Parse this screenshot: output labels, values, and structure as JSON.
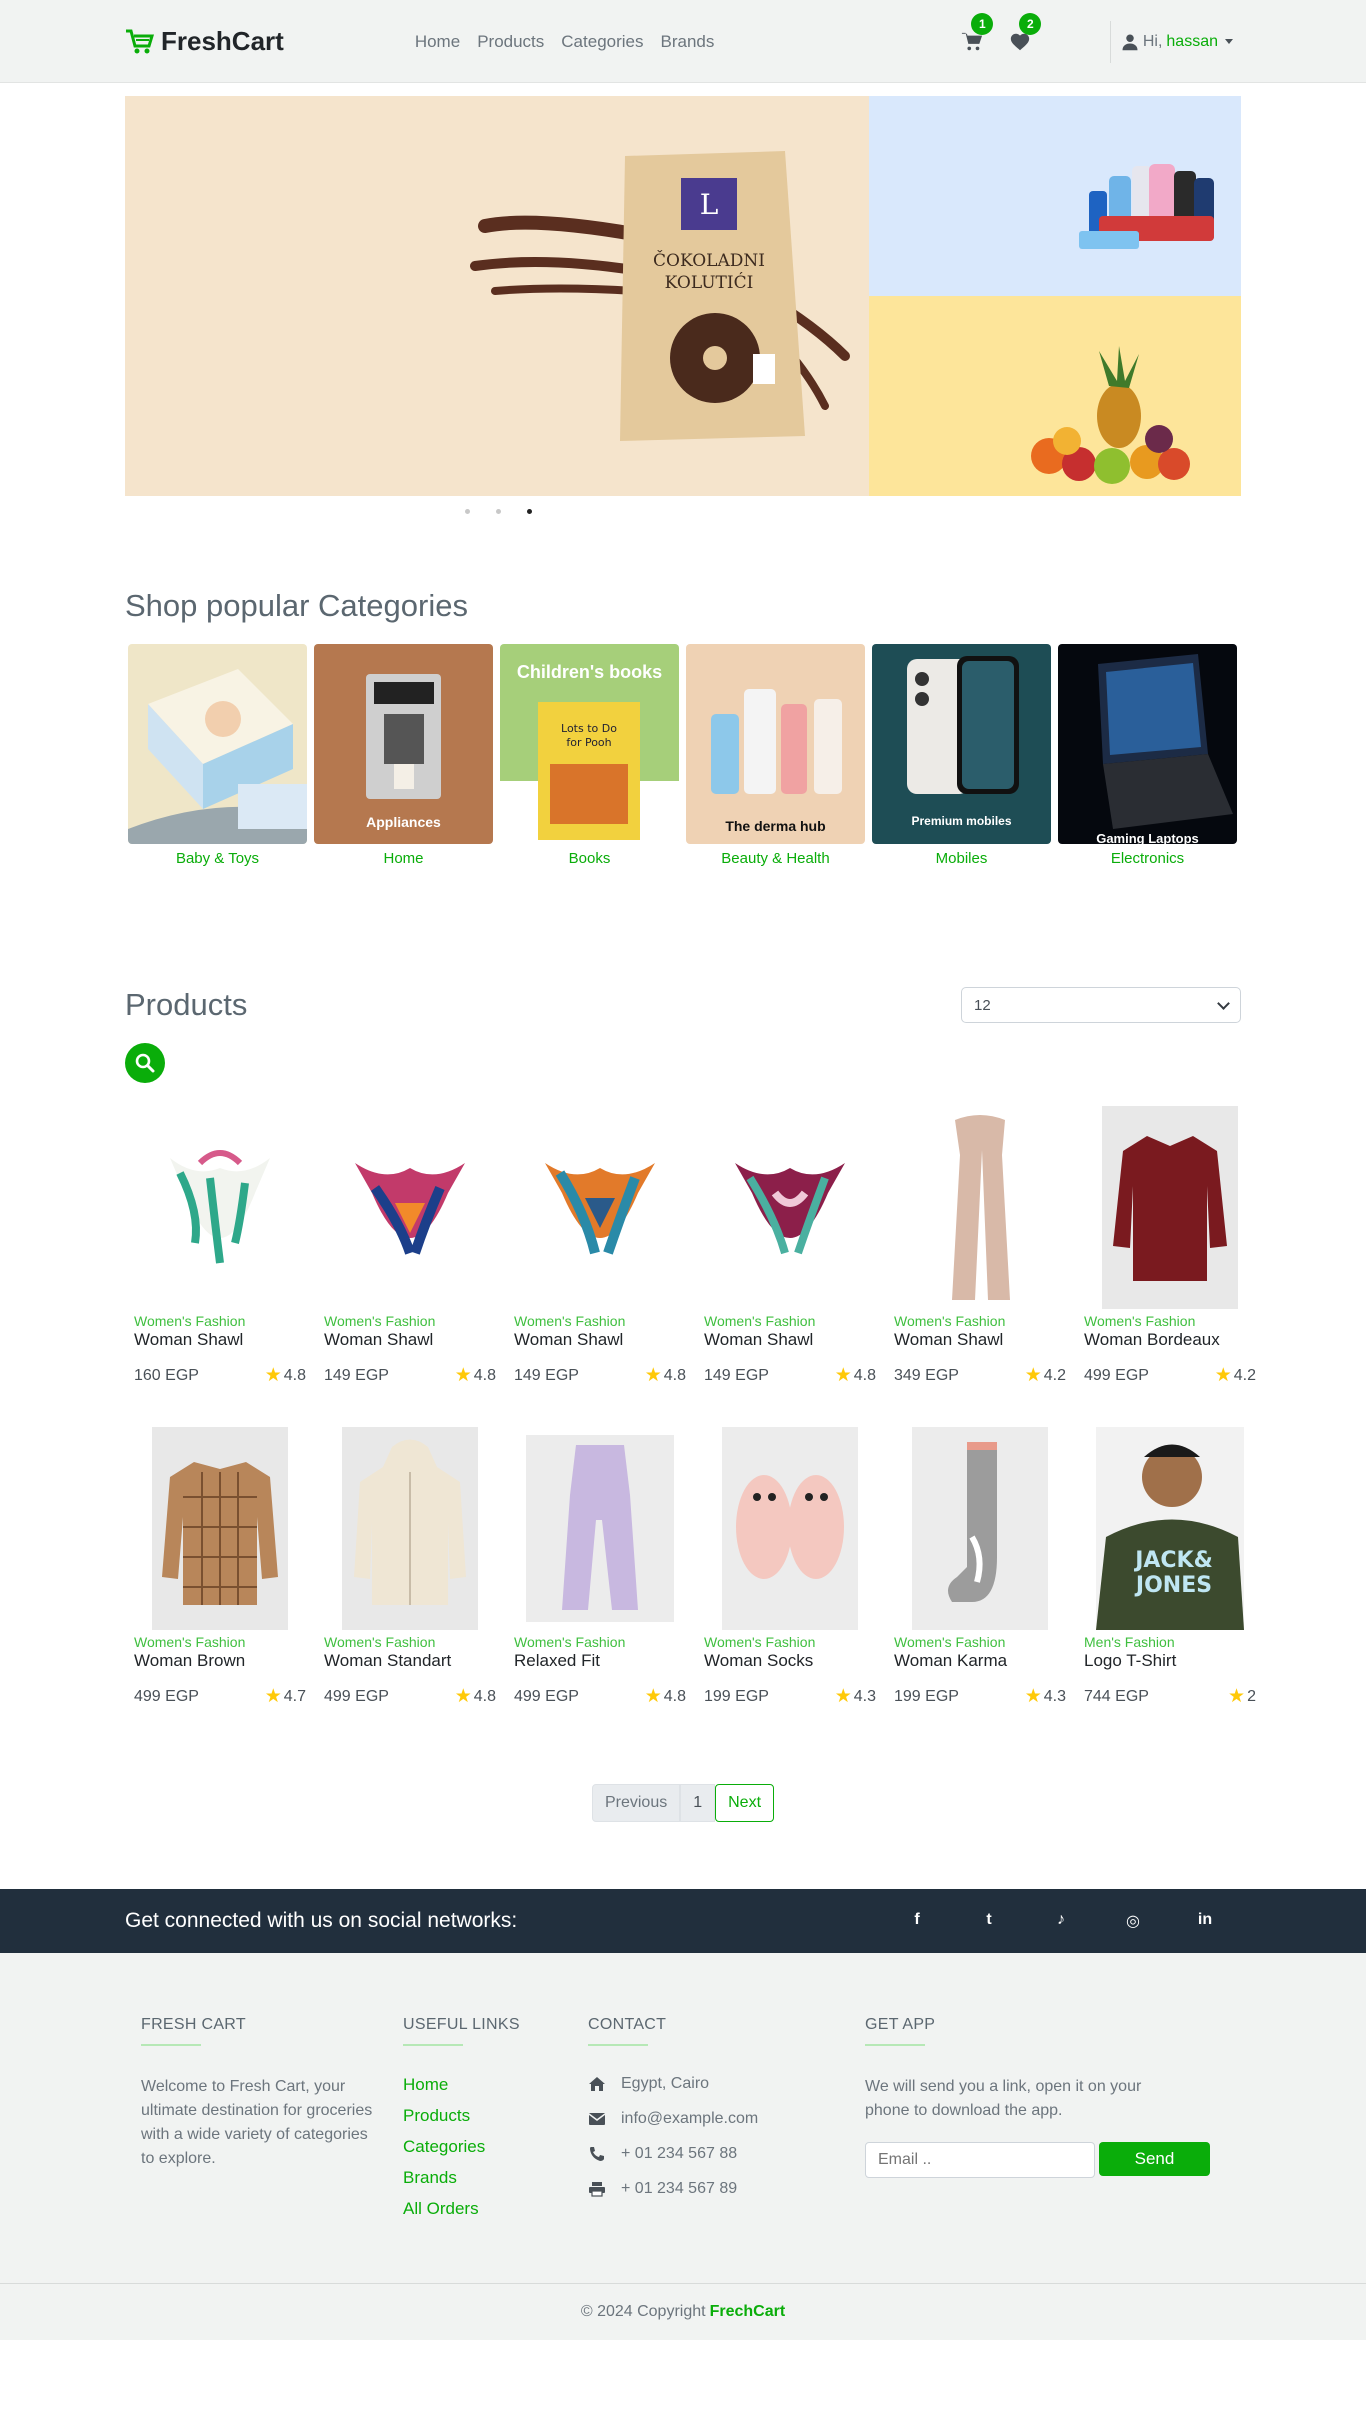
{
  "brand": {
    "name": "FreshCart"
  },
  "nav": {
    "links": [
      "Home",
      "Products",
      "Categories",
      "Brands"
    ]
  },
  "cart": {
    "count": "1"
  },
  "wishlist": {
    "count": "2"
  },
  "user": {
    "greeting": "Hi,",
    "name": "hassan"
  },
  "colors": {
    "accent": "#0aad0a",
    "dark": "#212f3d",
    "navbar_bg": "#f1f3f2"
  },
  "categories": {
    "title": "Shop popular Categories",
    "items": [
      {
        "name": "Baby & Toys",
        "overlay": ""
      },
      {
        "name": "Home",
        "overlay": "Appliances"
      },
      {
        "name": "Books",
        "overlay": "Children's books"
      },
      {
        "name": "Beauty & Health",
        "overlay": "The derma hub"
      },
      {
        "name": "Mobiles",
        "overlay": "Premium mobiles"
      },
      {
        "name": "Electronics",
        "overlay": "Gaming Laptops"
      }
    ]
  },
  "products": {
    "title": "Products",
    "page_size": "12",
    "items": [
      {
        "category": "Women's Fashion",
        "name": "Woman Shawl",
        "price": "160 EGP",
        "rating": "4.8"
      },
      {
        "category": "Women's Fashion",
        "name": "Woman Shawl",
        "price": "149 EGP",
        "rating": "4.8"
      },
      {
        "category": "Women's Fashion",
        "name": "Woman Shawl",
        "price": "149 EGP",
        "rating": "4.8"
      },
      {
        "category": "Women's Fashion",
        "name": "Woman Shawl",
        "price": "149 EGP",
        "rating": "4.8"
      },
      {
        "category": "Women's Fashion",
        "name": "Woman Shawl",
        "price": "349 EGP",
        "rating": "4.2"
      },
      {
        "category": "Women's Fashion",
        "name": "Woman Bordeaux",
        "price": "499 EGP",
        "rating": "4.2"
      },
      {
        "category": "Women's Fashion",
        "name": "Woman Brown",
        "price": "499 EGP",
        "rating": "4.7"
      },
      {
        "category": "Women's Fashion",
        "name": "Woman Standart",
        "price": "499 EGP",
        "rating": "4.8"
      },
      {
        "category": "Women's Fashion",
        "name": "Relaxed Fit",
        "price": "499 EGP",
        "rating": "4.8"
      },
      {
        "category": "Women's Fashion",
        "name": "Woman Socks",
        "price": "199 EGP",
        "rating": "4.3"
      },
      {
        "category": "Women's Fashion",
        "name": "Woman Karma",
        "price": "199 EGP",
        "rating": "4.3"
      },
      {
        "category": "Men's Fashion",
        "name": "Logo T-Shirt",
        "price": "744 EGP",
        "rating": "2"
      }
    ]
  },
  "pagination": {
    "prev": "Previous",
    "current": "1",
    "next": "Next"
  },
  "social": {
    "text": "Get connected with us on social networks:",
    "icons": [
      "facebook-icon",
      "twitter-icon",
      "tiktok-icon",
      "instagram-icon",
      "linkedin-icon"
    ]
  },
  "footer": {
    "about": {
      "title": "FRESH CART",
      "text": "Welcome to Fresh Cart, your ultimate destination for groceries with a wide variety of categories to explore."
    },
    "links": {
      "title": "USEFUL LINKS",
      "items": [
        "Home",
        "Products",
        "Categories",
        "Brands",
        "All Orders"
      ]
    },
    "contact": {
      "title": "CONTACT",
      "address": "Egypt, Cairo",
      "email": "info@example.com",
      "phone": "+ 01 234 567 88",
      "fax": "+ 01 234 567 89"
    },
    "app": {
      "title": "GET APP",
      "text": "We will send you a link, open it on your phone to download the app.",
      "email_placeholder": "Email ..",
      "send_label": "Send"
    }
  },
  "copyright": {
    "text": "© 2024 Copyright",
    "brand": "FrechCart"
  }
}
